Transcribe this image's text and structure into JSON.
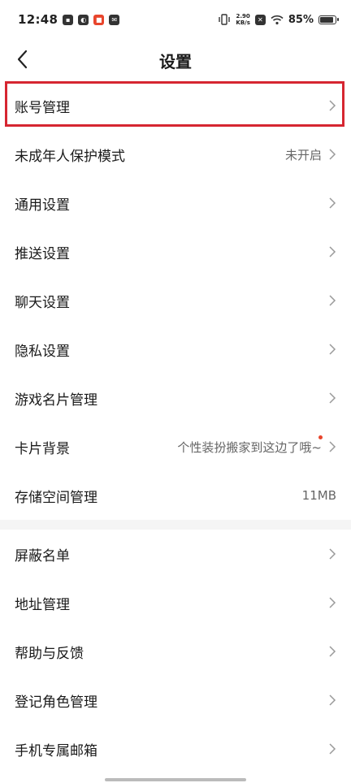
{
  "status_bar": {
    "time": "12:48",
    "net_speed_value": "2.90",
    "net_speed_unit": "KB/s",
    "battery_percent": "85%",
    "icons": [
      "app-icon-1",
      "app-icon-2",
      "app-icon-3",
      "message-icon",
      "vibrate-icon",
      "data-off-icon",
      "wifi-icon",
      "battery-icon"
    ]
  },
  "header": {
    "title": "设置",
    "back_icon": "chevron-left-icon"
  },
  "sections": [
    {
      "items": [
        {
          "label": "账号管理",
          "value": "",
          "chevron": true,
          "highlighted": true
        },
        {
          "label": "未成年人保护模式",
          "value": "未开启",
          "chevron": true
        },
        {
          "label": "通用设置",
          "value": "",
          "chevron": true
        },
        {
          "label": "推送设置",
          "value": "",
          "chevron": true
        },
        {
          "label": "聊天设置",
          "value": "",
          "chevron": true
        },
        {
          "label": "隐私设置",
          "value": "",
          "chevron": true
        },
        {
          "label": "游戏名片管理",
          "value": "",
          "chevron": true
        },
        {
          "label": "卡片背景",
          "value": "个性装扮搬家到这边了哦~",
          "chevron": true,
          "dot": true
        },
        {
          "label": "存储空间管理",
          "value": "11MB",
          "chevron": false
        }
      ]
    },
    {
      "items": [
        {
          "label": "屏蔽名单",
          "value": "",
          "chevron": true
        },
        {
          "label": "地址管理",
          "value": "",
          "chevron": true
        },
        {
          "label": "帮助与反馈",
          "value": "",
          "chevron": true
        },
        {
          "label": "登记角色管理",
          "value": "",
          "chevron": true
        },
        {
          "label": "手机专属邮箱",
          "value": "",
          "chevron": true
        }
      ]
    }
  ],
  "colors": {
    "highlight": "#d62631",
    "dot": "#e8452c",
    "divider": "#f5f5f5"
  }
}
